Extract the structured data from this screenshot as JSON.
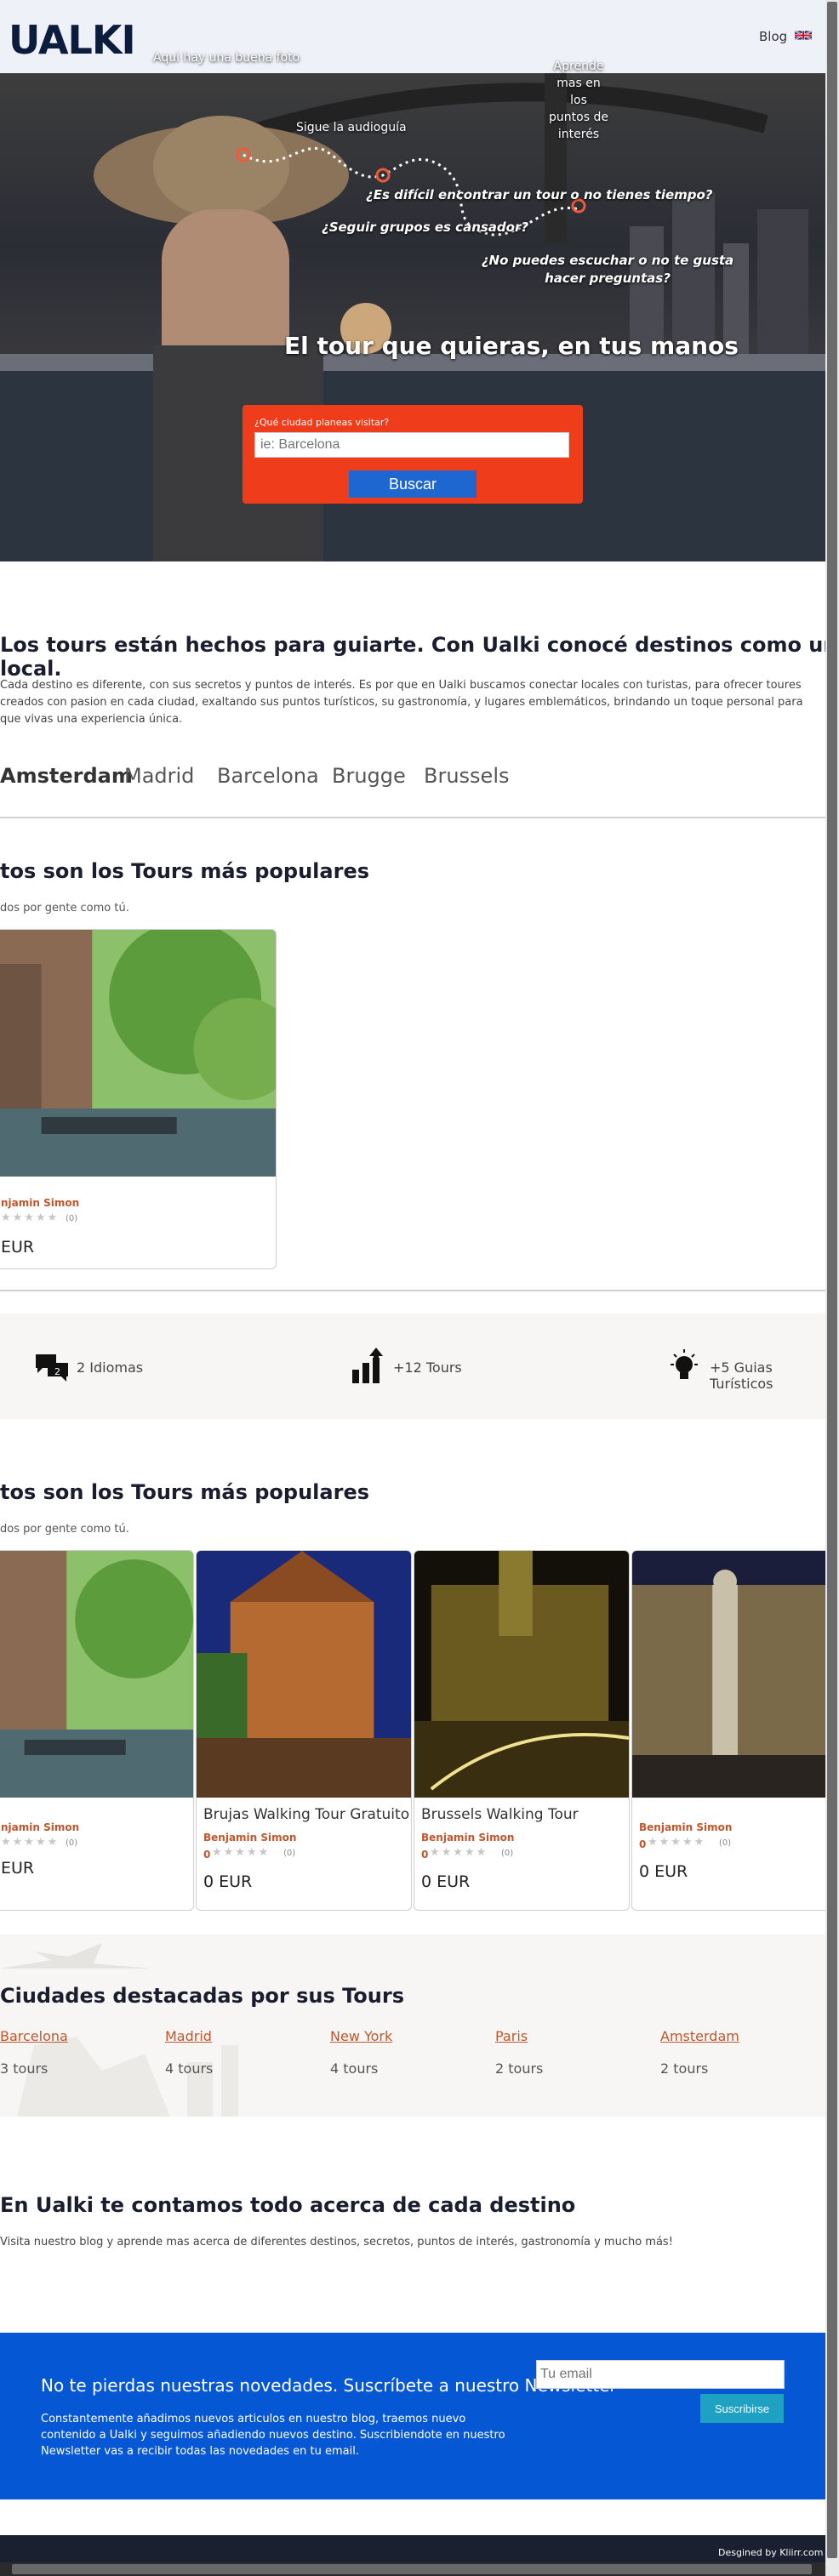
{
  "header": {
    "logo": "UALKI",
    "blog_label": "Blog",
    "flag_icon": "uk-flag-icon"
  },
  "hero": {
    "callouts": {
      "photo": "Aqui hay una buena foto",
      "audio": "Sigue la audioguía",
      "learn": "Aprende mas en los puntos de interés"
    },
    "questions": [
      "¿Es difícil encontrar un tour o no tienes tiempo?",
      "¿Seguir grupos es cansador?",
      "¿No puedes escuchar o no te gusta hacer preguntas?"
    ],
    "title": "El tour que quieras, en tus manos",
    "search": {
      "label": "¿Qué ciudad planeas visitar?",
      "placeholder": "ie: Barcelona",
      "button": "Buscar"
    }
  },
  "intro": {
    "heading": "Los tours están hechos para guiarte. Con Ualki conocé destinos como un local.",
    "paragraph": "Cada destino es diferente, con sus secretos y puntos de interés. Es por que en Ualki buscamos conectar locales con turistas, para ofrecer toures creados con pasion en cada ciudad, exaltando sus puntos turísticos, su gastronomía, y lugares emblemáticos, brindando un toque personal para que vivas una experiencia única."
  },
  "city_tabs": [
    "Amsterdam",
    "Madrid",
    "Barcelona",
    "Brugge",
    "Brussels"
  ],
  "popular1": {
    "heading": "tos son los Tours más populares",
    "subtitle": "dos por gente como tú.",
    "cards": [
      {
        "title": "",
        "author": "njamin Simon",
        "rating": "",
        "stars": "★★★★★",
        "count": "(0)",
        "price": "EUR"
      }
    ]
  },
  "stats": [
    {
      "icon": "chat-bubbles-icon",
      "label": "2 Idiomas"
    },
    {
      "icon": "growth-chart-icon",
      "label": "+12 Tours"
    },
    {
      "icon": "lightbulb-icon",
      "label": "+5 Guias Turísticos"
    }
  ],
  "popular2": {
    "heading": "tos son los Tours más populares",
    "subtitle": "dos por gente como tú.",
    "cards": [
      {
        "title": "",
        "author": "njamin Simon",
        "rating": "",
        "stars": "★★★★★",
        "count": "(0)",
        "price": "EUR"
      },
      {
        "title": "Brujas Walking Tour Gratuito",
        "author": "Benjamin Simon",
        "rating": "0",
        "stars": "★★★★★",
        "count": "(0)",
        "price": "0 EUR"
      },
      {
        "title": "Brussels Walking Tour",
        "author": "Benjamin Simon",
        "rating": "0",
        "stars": "★★★★★",
        "count": "(0)",
        "price": "0 EUR"
      },
      {
        "title": "",
        "author": "Benjamin Simon",
        "rating": "0",
        "stars": "★★★★★",
        "count": "(0)",
        "price": "0 EUR"
      }
    ]
  },
  "cities": {
    "heading": "Ciudades destacadas por sus Tours",
    "items": [
      {
        "name": "Barcelona",
        "count": "3 tours"
      },
      {
        "name": "Madrid",
        "count": "4 tours"
      },
      {
        "name": "New York",
        "count": "4 tours"
      },
      {
        "name": "Paris",
        "count": "2 tours"
      },
      {
        "name": "Amsterdam",
        "count": "2 tours"
      }
    ]
  },
  "blog": {
    "heading": "En Ualki te contamos todo acerca de cada destino",
    "paragraph": "Visita nuestro blog y aprende mas acerca de diferentes destinos, secretos, puntos de interés, gastronomía y mucho más!"
  },
  "newsletter": {
    "heading": "No te pierdas nuestras novedades. Suscríbete a nuestro Newsletter",
    "paragraph": "Constantemente añadimos nuevos articulos en nuestro blog, traemos nuevo contenido a Ualki y seguimos añadiendo nuevos destino. Suscribiendote en nuestro Newsletter vas a recibir todas las novedades en tu email.",
    "placeholder": "Tu email",
    "button": "Suscribirse"
  },
  "footer": {
    "credit": "Desgined by Kliirr.com"
  },
  "colors": {
    "accent_orange": "#ef3c1a",
    "button_blue": "#1f67d0",
    "newsletter_blue": "#0657d4",
    "author_color": "#c0562c",
    "footer_dark": "#1b2030"
  }
}
